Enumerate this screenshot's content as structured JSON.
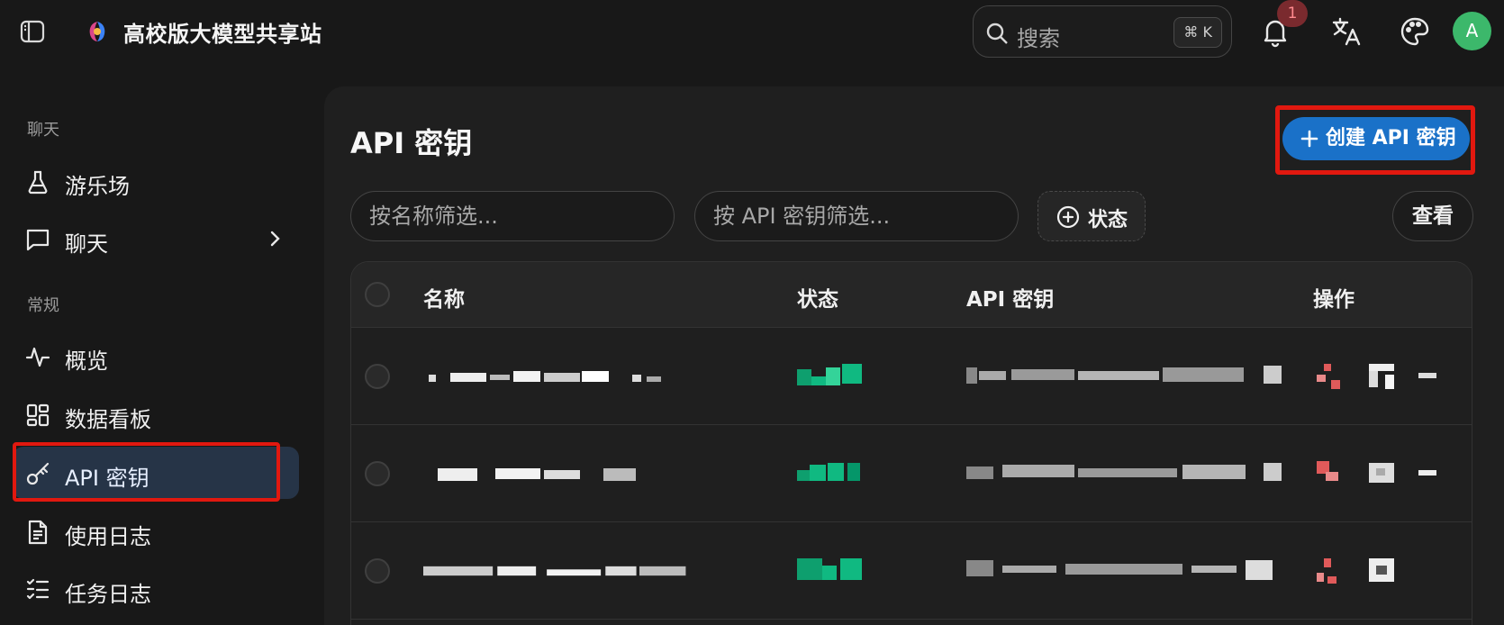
{
  "header": {
    "app_title": "高校版大模型共享站",
    "search_placeholder": "搜索",
    "search_shortcut": "⌘ K",
    "notification_count": "1",
    "avatar_initial": "A"
  },
  "sidebar": {
    "section_chat": "聊天",
    "section_general": "常规",
    "items": [
      {
        "label": "游乐场",
        "icon": "flask-icon"
      },
      {
        "label": "聊天",
        "icon": "message-square-icon"
      },
      {
        "label": "概览",
        "icon": "activity-icon"
      },
      {
        "label": "数据看板",
        "icon": "dashboard-grid-icon"
      },
      {
        "label": "API 密钥",
        "icon": "key-icon",
        "active": true
      },
      {
        "label": "使用日志",
        "icon": "file-text-icon"
      },
      {
        "label": "任务日志",
        "icon": "list-checks-icon"
      }
    ]
  },
  "main": {
    "title": "API 密钥",
    "create_button": "创建 API 密钥",
    "filter_name_placeholder": "按名称筛选...",
    "filter_key_placeholder": "按 API 密钥筛选...",
    "status_filter": "状态",
    "view_button": "查看"
  },
  "table": {
    "columns": [
      "名称",
      "状态",
      "API 密钥",
      "操作"
    ],
    "rows": [
      {
        "name": "",
        "status": "",
        "key": ""
      },
      {
        "name": "",
        "status": "",
        "key": ""
      },
      {
        "name": "",
        "status": "",
        "key": ""
      }
    ]
  },
  "colors": {
    "background": "#181818",
    "panel": "#1f1f1f",
    "accent_blue": "#1a71c8",
    "active_nav": "#263447",
    "highlight_red": "#e1180f",
    "status_green": "#10b981",
    "delete_red": "#e05a5a",
    "avatar_green": "#3cb86b"
  }
}
